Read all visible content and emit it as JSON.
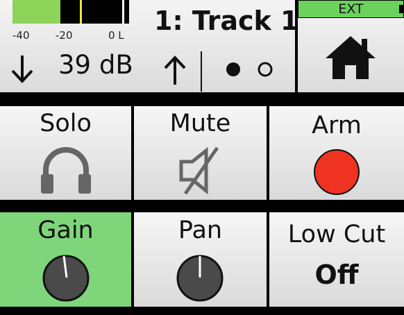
{
  "header": {
    "track_title": "1: Track 1",
    "meter": {
      "scale_labels": [
        "-40",
        "-20",
        "0 L"
      ],
      "level_fraction": 0.41
    },
    "gain_readout": "39 dB",
    "down_icon": "down-arrow-icon",
    "up_icon": "up-arrow-icon",
    "page_indicator": {
      "pages": 2,
      "current": 1
    },
    "ext_label": "EXT",
    "home_icon": "home-icon"
  },
  "controls": [
    {
      "id": "solo",
      "label": "Solo",
      "icon": "headphones-icon",
      "active": false
    },
    {
      "id": "mute",
      "label": "Mute",
      "icon": "speaker-muted-icon",
      "active": false
    },
    {
      "id": "arm",
      "label": "Arm",
      "icon": "record-dot-icon",
      "active": false,
      "color": "#ee3322"
    },
    {
      "id": "gain",
      "label": "Gain",
      "icon": "knob-icon",
      "active": true,
      "color": "#7fd67a"
    },
    {
      "id": "pan",
      "label": "Pan",
      "icon": "knob-icon",
      "active": false
    },
    {
      "id": "lowcut",
      "label": "Low Cut",
      "value": "Off",
      "active": false
    }
  ]
}
